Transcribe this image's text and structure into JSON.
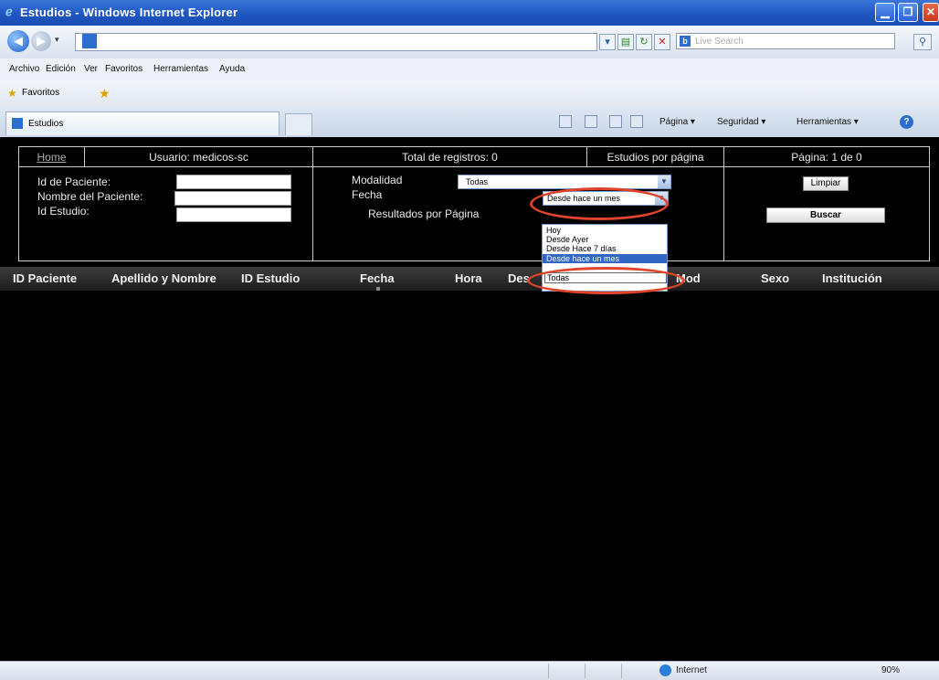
{
  "window": {
    "title": "Estudios - Windows Internet Explorer"
  },
  "browser": {
    "search_placeholder": "Live Search",
    "menu": [
      "Archivo",
      "Edición",
      "Ver",
      "Favoritos",
      "Herramientas",
      "Ayuda"
    ],
    "favorites_label": "Favoritos",
    "tab_label": "Estudios",
    "commands": {
      "page": "Página ▾",
      "security": "Seguridad ▾",
      "tools": "Herramientas ▾"
    },
    "status": {
      "zone": "Internet",
      "zoom": "90%"
    }
  },
  "header": {
    "home": "Home",
    "user": "Usuario: medicos-sc",
    "total": "Total de registros: 0",
    "per_page": "Estudios por página",
    "page": "Página: 1 de 0"
  },
  "form": {
    "patient_id_label": "Id de Paciente:",
    "patient_name_label": "Nombre del Paciente:",
    "study_id_label": "Id Estudio:",
    "modality_label": "Modalidad",
    "modality_value": "Todas",
    "date_label": "Fecha",
    "date_value": "Desde hace un mes",
    "results_label": "Resultados por Página",
    "date_options": [
      "Hoy",
      "Desde Ayer",
      "Desde Hace 7 días",
      "Desde hace un mes",
      "Todas"
    ],
    "clear_button": "Limpiar",
    "search_button": "Buscar"
  },
  "columns": [
    "ID Paciente",
    "Apellido y Nombre",
    "ID Estudio",
    "Fecha",
    "Hora",
    "Des",
    "Mod",
    "Sexo",
    "Institución"
  ],
  "colors": {
    "highlight_circle": "#e0442a",
    "selection": "#3166c4"
  }
}
